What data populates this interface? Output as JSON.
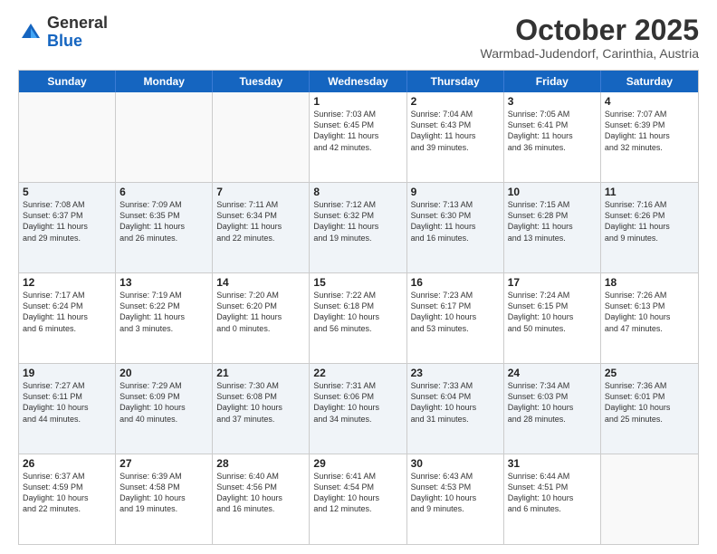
{
  "header": {
    "logo_general": "General",
    "logo_blue": "Blue",
    "month_title": "October 2025",
    "subtitle": "Warmbad-Judendorf, Carinthia, Austria"
  },
  "days_of_week": [
    "Sunday",
    "Monday",
    "Tuesday",
    "Wednesday",
    "Thursday",
    "Friday",
    "Saturday"
  ],
  "rows": [
    {
      "alt": false,
      "cells": [
        {
          "day": "",
          "info": "",
          "empty": true
        },
        {
          "day": "",
          "info": "",
          "empty": true
        },
        {
          "day": "",
          "info": "",
          "empty": true
        },
        {
          "day": "1",
          "info": "Sunrise: 7:03 AM\nSunset: 6:45 PM\nDaylight: 11 hours\nand 42 minutes."
        },
        {
          "day": "2",
          "info": "Sunrise: 7:04 AM\nSunset: 6:43 PM\nDaylight: 11 hours\nand 39 minutes."
        },
        {
          "day": "3",
          "info": "Sunrise: 7:05 AM\nSunset: 6:41 PM\nDaylight: 11 hours\nand 36 minutes."
        },
        {
          "day": "4",
          "info": "Sunrise: 7:07 AM\nSunset: 6:39 PM\nDaylight: 11 hours\nand 32 minutes."
        }
      ]
    },
    {
      "alt": true,
      "cells": [
        {
          "day": "5",
          "info": "Sunrise: 7:08 AM\nSunset: 6:37 PM\nDaylight: 11 hours\nand 29 minutes."
        },
        {
          "day": "6",
          "info": "Sunrise: 7:09 AM\nSunset: 6:35 PM\nDaylight: 11 hours\nand 26 minutes."
        },
        {
          "day": "7",
          "info": "Sunrise: 7:11 AM\nSunset: 6:34 PM\nDaylight: 11 hours\nand 22 minutes."
        },
        {
          "day": "8",
          "info": "Sunrise: 7:12 AM\nSunset: 6:32 PM\nDaylight: 11 hours\nand 19 minutes."
        },
        {
          "day": "9",
          "info": "Sunrise: 7:13 AM\nSunset: 6:30 PM\nDaylight: 11 hours\nand 16 minutes."
        },
        {
          "day": "10",
          "info": "Sunrise: 7:15 AM\nSunset: 6:28 PM\nDaylight: 11 hours\nand 13 minutes."
        },
        {
          "day": "11",
          "info": "Sunrise: 7:16 AM\nSunset: 6:26 PM\nDaylight: 11 hours\nand 9 minutes."
        }
      ]
    },
    {
      "alt": false,
      "cells": [
        {
          "day": "12",
          "info": "Sunrise: 7:17 AM\nSunset: 6:24 PM\nDaylight: 11 hours\nand 6 minutes."
        },
        {
          "day": "13",
          "info": "Sunrise: 7:19 AM\nSunset: 6:22 PM\nDaylight: 11 hours\nand 3 minutes."
        },
        {
          "day": "14",
          "info": "Sunrise: 7:20 AM\nSunset: 6:20 PM\nDaylight: 11 hours\nand 0 minutes."
        },
        {
          "day": "15",
          "info": "Sunrise: 7:22 AM\nSunset: 6:18 PM\nDaylight: 10 hours\nand 56 minutes."
        },
        {
          "day": "16",
          "info": "Sunrise: 7:23 AM\nSunset: 6:17 PM\nDaylight: 10 hours\nand 53 minutes."
        },
        {
          "day": "17",
          "info": "Sunrise: 7:24 AM\nSunset: 6:15 PM\nDaylight: 10 hours\nand 50 minutes."
        },
        {
          "day": "18",
          "info": "Sunrise: 7:26 AM\nSunset: 6:13 PM\nDaylight: 10 hours\nand 47 minutes."
        }
      ]
    },
    {
      "alt": true,
      "cells": [
        {
          "day": "19",
          "info": "Sunrise: 7:27 AM\nSunset: 6:11 PM\nDaylight: 10 hours\nand 44 minutes."
        },
        {
          "day": "20",
          "info": "Sunrise: 7:29 AM\nSunset: 6:09 PM\nDaylight: 10 hours\nand 40 minutes."
        },
        {
          "day": "21",
          "info": "Sunrise: 7:30 AM\nSunset: 6:08 PM\nDaylight: 10 hours\nand 37 minutes."
        },
        {
          "day": "22",
          "info": "Sunrise: 7:31 AM\nSunset: 6:06 PM\nDaylight: 10 hours\nand 34 minutes."
        },
        {
          "day": "23",
          "info": "Sunrise: 7:33 AM\nSunset: 6:04 PM\nDaylight: 10 hours\nand 31 minutes."
        },
        {
          "day": "24",
          "info": "Sunrise: 7:34 AM\nSunset: 6:03 PM\nDaylight: 10 hours\nand 28 minutes."
        },
        {
          "day": "25",
          "info": "Sunrise: 7:36 AM\nSunset: 6:01 PM\nDaylight: 10 hours\nand 25 minutes."
        }
      ]
    },
    {
      "alt": false,
      "cells": [
        {
          "day": "26",
          "info": "Sunrise: 6:37 AM\nSunset: 4:59 PM\nDaylight: 10 hours\nand 22 minutes."
        },
        {
          "day": "27",
          "info": "Sunrise: 6:39 AM\nSunset: 4:58 PM\nDaylight: 10 hours\nand 19 minutes."
        },
        {
          "day": "28",
          "info": "Sunrise: 6:40 AM\nSunset: 4:56 PM\nDaylight: 10 hours\nand 16 minutes."
        },
        {
          "day": "29",
          "info": "Sunrise: 6:41 AM\nSunset: 4:54 PM\nDaylight: 10 hours\nand 12 minutes."
        },
        {
          "day": "30",
          "info": "Sunrise: 6:43 AM\nSunset: 4:53 PM\nDaylight: 10 hours\nand 9 minutes."
        },
        {
          "day": "31",
          "info": "Sunrise: 6:44 AM\nSunset: 4:51 PM\nDaylight: 10 hours\nand 6 minutes."
        },
        {
          "day": "",
          "info": "",
          "empty": true
        }
      ]
    }
  ]
}
